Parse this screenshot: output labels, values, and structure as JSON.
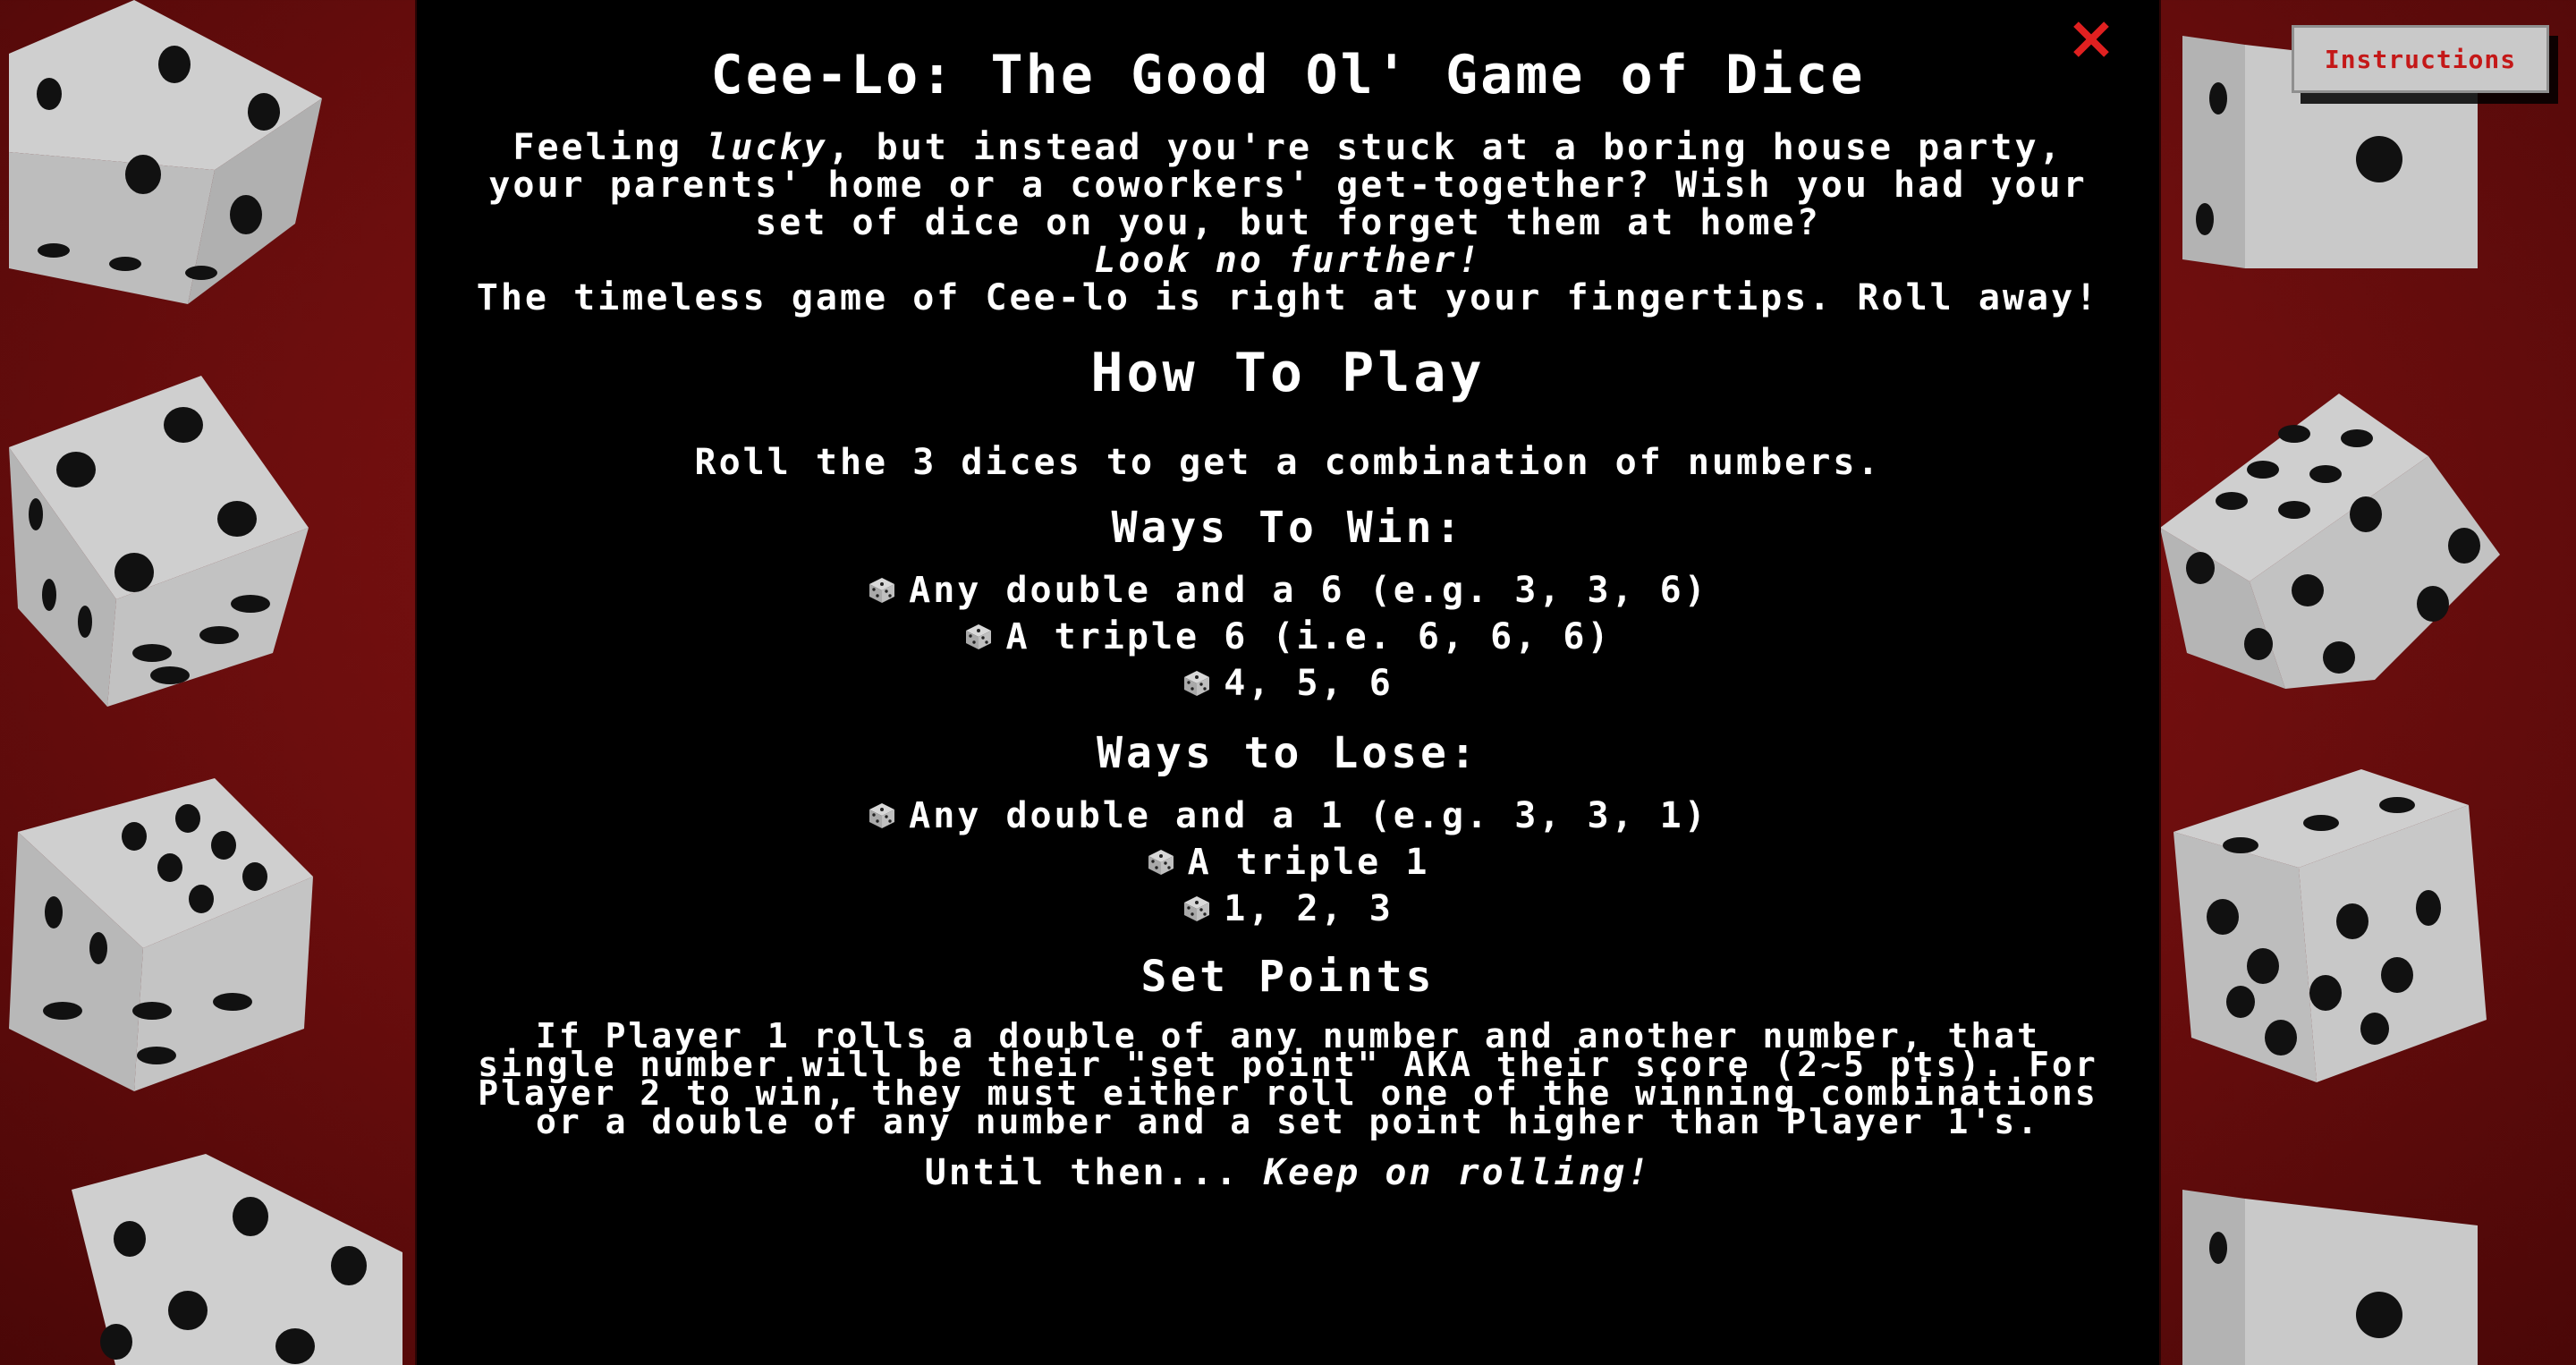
{
  "colors": {
    "background": "#7a1010",
    "modal": "#000000",
    "text": "#ffffff",
    "close": "#e02020",
    "button_text": "#c41818",
    "button_bg": "#c9c9c9",
    "die_face": "#d6d6d6",
    "die_pip": "#111111"
  },
  "modal": {
    "title": "Cee-Lo: The Good Ol' Game of Dice",
    "intro": {
      "line1_pre": "Feeling ",
      "line1_em": "lucky",
      "line1_post": ", but instead you're stuck at a boring house party, your parents' home or a coworkers' get-together? Wish you had your set of dice on you, but forget them at home?",
      "look": "Look no further!",
      "line2": "The timeless game of Cee-lo is right at your fingertips. Roll away!"
    },
    "how_to_play": "How To Play",
    "roll_text": "Roll the 3 dices to get a combination of numbers.",
    "ways_to_win": {
      "heading": "Ways To Win:",
      "items": [
        "Any double and a 6 (e.g. 3, 3, 6)",
        "A triple 6 (i.e. 6, 6, 6)",
        "4, 5, 6"
      ]
    },
    "ways_to_lose": {
      "heading": "Ways to Lose:",
      "items": [
        "Any double and a 1 (e.g. 3, 3, 1)",
        "A triple 1",
        "1, 2, 3"
      ]
    },
    "set_points": {
      "heading": "Set Points",
      "text": "If Player 1 rolls a double of any number and another number, that single number will be their \"set point\" AKA their score (2~5 pts). For Player 2 to win, they must either roll one of the winning combinations or a double of any number and a set point higher than Player 1's."
    },
    "outro": {
      "pre": "Until then... ",
      "em": "Keep on rolling!"
    }
  },
  "instructions_button": {
    "label": "Instructions"
  },
  "icons": {
    "close": "close-icon",
    "bullet": "die-icon"
  }
}
